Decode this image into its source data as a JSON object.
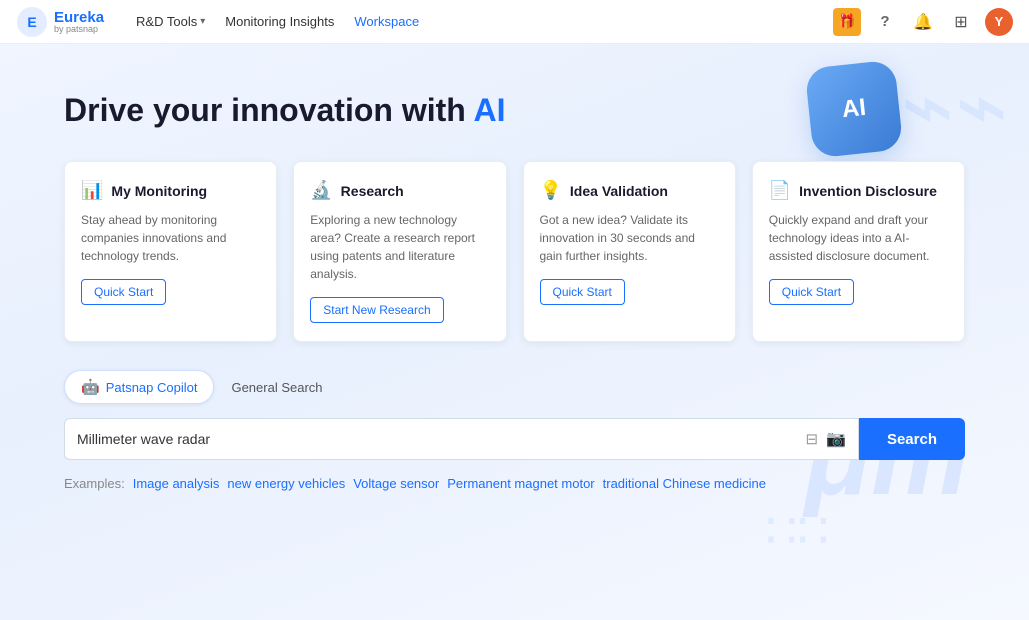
{
  "navbar": {
    "logo_text": "Eureka",
    "logo_sub": "by patsnap",
    "nav_items": [
      {
        "label": "R&D Tools",
        "has_dropdown": true
      },
      {
        "label": "Monitoring Insights",
        "has_dropdown": false
      },
      {
        "label": "Workspace",
        "has_dropdown": false
      }
    ],
    "icons": {
      "gift": "🎁",
      "help": "?",
      "bell": "🔔",
      "grid": "⊞",
      "avatar": "Y"
    }
  },
  "hero": {
    "title_part1": "Drive your innovation with ",
    "title_ai": "AI"
  },
  "cards": [
    {
      "icon": "📊",
      "title": "My Monitoring",
      "desc": "Stay ahead by monitoring companies innovations and technology trends.",
      "btn_label": "Quick Start"
    },
    {
      "icon": "🔬",
      "title": "Research",
      "desc": "Exploring a new technology area? Create a research report using patents and literature analysis.",
      "btn_label": "Start New Research"
    },
    {
      "icon": "💡",
      "title": "Idea Validation",
      "desc": "Got a new idea? Validate its innovation in 30 seconds and gain further insights.",
      "btn_label": "Quick Start"
    },
    {
      "icon": "📄",
      "title": "Invention Disclosure",
      "desc": "Quickly expand and draft your technology ideas into a AI-assisted disclosure document.",
      "btn_label": "Quick Start"
    }
  ],
  "tabs": [
    {
      "label": "Patsnap Copilot",
      "icon": "🤖",
      "active": true
    },
    {
      "label": "General Search",
      "icon": "",
      "active": false
    }
  ],
  "search": {
    "placeholder": "Millimeter wave radar",
    "value": "Millimeter wave radar",
    "btn_label": "Search"
  },
  "examples": {
    "label": "Examples:",
    "items": [
      "Image analysis",
      "new energy vehicles",
      "Voltage sensor",
      "Permanent magnet motor",
      "traditional Chinese medicine"
    ]
  }
}
